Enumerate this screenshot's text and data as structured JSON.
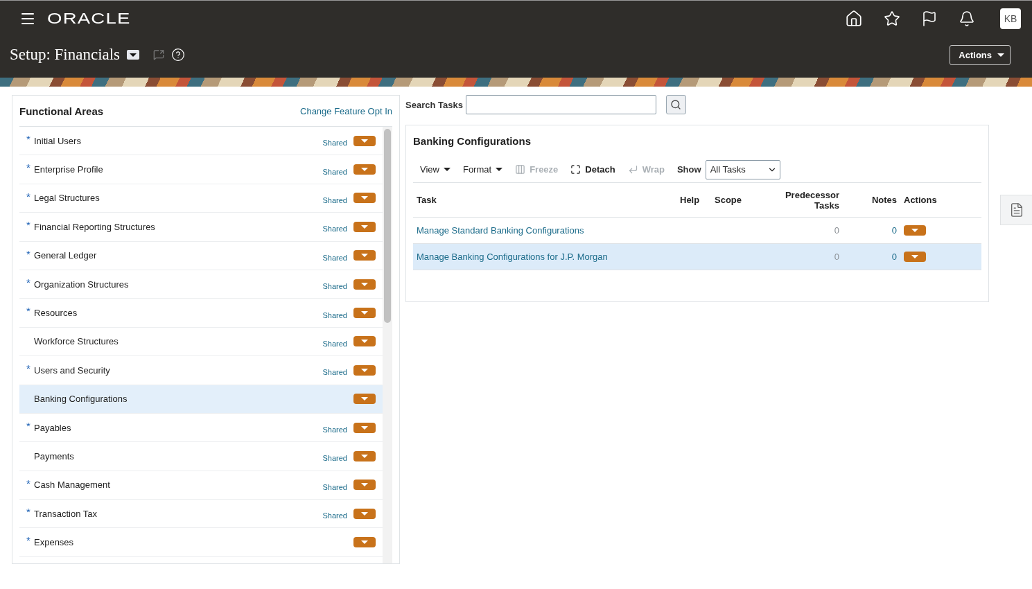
{
  "header": {
    "logo": "ORACLE",
    "avatar": "KB"
  },
  "page": {
    "title": "Setup: Financials",
    "actions": "Actions"
  },
  "functional_areas": {
    "title": "Functional Areas",
    "link": "Change Feature Opt In",
    "items": [
      {
        "marker": "*",
        "label": "Initial Users",
        "scope": "Shared",
        "selected": false
      },
      {
        "marker": "*",
        "label": "Enterprise Profile",
        "scope": "Shared",
        "selected": false
      },
      {
        "marker": "*",
        "label": "Legal Structures",
        "scope": "Shared",
        "selected": false
      },
      {
        "marker": "*",
        "label": "Financial Reporting Structures",
        "scope": "Shared",
        "selected": false
      },
      {
        "marker": "*",
        "label": "General Ledger",
        "scope": "Shared",
        "selected": false
      },
      {
        "marker": "*",
        "label": "Organization Structures",
        "scope": "Shared",
        "selected": false
      },
      {
        "marker": "*",
        "label": "Resources",
        "scope": "Shared",
        "selected": false
      },
      {
        "label": "Workforce Structures",
        "scope": "Shared",
        "selected": false
      },
      {
        "marker": "*",
        "label": "Users and Security",
        "scope": "Shared",
        "selected": false
      },
      {
        "label": "Banking Configurations",
        "selected": true
      },
      {
        "marker": "*",
        "label": "Payables",
        "scope": "Shared",
        "selected": false
      },
      {
        "label": "Payments",
        "scope": "Shared",
        "selected": false
      },
      {
        "marker": "*",
        "label": "Cash Management",
        "scope": "Shared",
        "selected": false
      },
      {
        "marker": "*",
        "label": "Transaction Tax",
        "scope": "Shared",
        "selected": false
      },
      {
        "marker": "*",
        "label": "Expenses",
        "selected": false
      }
    ]
  },
  "search": {
    "label": "Search Tasks"
  },
  "tasks": {
    "title": "Banking Configurations",
    "toolbar": [
      {
        "label": "View",
        "kind": "menu",
        "disabled": false
      },
      {
        "label": "Format",
        "kind": "menu",
        "disabled": false
      },
      {
        "label": "Freeze",
        "kind": "freeze",
        "disabled": true
      },
      {
        "label": "Detach",
        "kind": "detach",
        "disabled": false
      },
      {
        "label": "Wrap",
        "kind": "wrap",
        "disabled": true
      }
    ],
    "show": {
      "label": "Show",
      "value": "All Tasks"
    },
    "columns": [
      "Task",
      "Help",
      "Scope",
      "Predecessor Tasks",
      "Notes",
      "Actions"
    ],
    "rows": [
      {
        "task": "Manage Standard Banking Configurations",
        "predecessor": "0",
        "notes": "0",
        "selected": false
      },
      {
        "task": "Manage Banking Configurations for J.P. Morgan",
        "predecessor": "0",
        "notes": "0",
        "selected": true
      }
    ]
  }
}
